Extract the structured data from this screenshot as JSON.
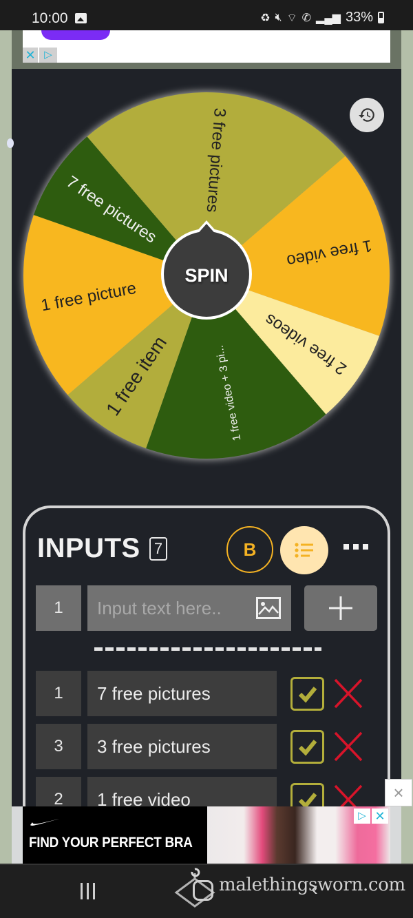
{
  "status_bar": {
    "time": "10:00",
    "battery": "33%",
    "icons": [
      "gallery-icon",
      "battery-saver-icon",
      "mute-icon",
      "wifi-icon",
      "wifi-call-icon",
      "signal-icon",
      "battery-icon"
    ]
  },
  "top_ad": {
    "close_glyph": "✕",
    "adchoices_glyph": "▷"
  },
  "wheel": {
    "center_label": "SPIN",
    "history_icon": "history-icon",
    "slices": [
      {
        "label": "1 free video",
        "weight": 2,
        "color": "#F8B71F",
        "text_color": "#222222"
      },
      {
        "label": "2 free videos",
        "weight": 1,
        "color": "#FCEB9D",
        "text_color": "#222222"
      },
      {
        "label": "1 free video + 3 pi...",
        "weight": 2,
        "color": "#2E5C0F",
        "text_color": "#F0F0F0"
      },
      {
        "label": "1 free item",
        "weight": 1,
        "color": "#B2AD3C",
        "text_color": "#222222"
      },
      {
        "label": "1 free picture",
        "weight": 2,
        "color": "#F8B71F",
        "text_color": "#222222"
      },
      {
        "label": "7 free pictures",
        "weight": 1,
        "color": "#2E5C0F",
        "text_color": "#F0F0F0"
      },
      {
        "label": "3 free pictures",
        "weight": 3,
        "color": "#B2AD3C",
        "text_color": "#222222"
      }
    ]
  },
  "inputs": {
    "title": "INPUTS",
    "count": "7",
    "bold_button_label": "B",
    "list_icon": "list-icon",
    "more_icon": "more-icon",
    "new_entry": {
      "weight": "1",
      "placeholder": "Input text here..",
      "value": "",
      "image_icon": "image-icon",
      "add_icon": "plus-icon"
    },
    "entries": [
      {
        "weight": "1",
        "text": "7 free pictures",
        "checked": true
      },
      {
        "weight": "3",
        "text": "3 free pictures",
        "checked": true
      },
      {
        "weight": "2",
        "text": "1 free video",
        "checked": true
      }
    ]
  },
  "bottom_ad": {
    "headline": "FIND YOUR PERFECT BRA",
    "brand_icon": "nike-swoosh-icon",
    "adchoices_glyph": "▷",
    "close_glyph": "✕",
    "overlay_close_glyph": "×"
  },
  "nav_bar": {
    "watermark": "malethingsworn.com"
  },
  "colors": {
    "page_bg": "#1F2228",
    "accent": "#F4B223",
    "check": "#B3AE3B",
    "delete": "#D8142A"
  }
}
